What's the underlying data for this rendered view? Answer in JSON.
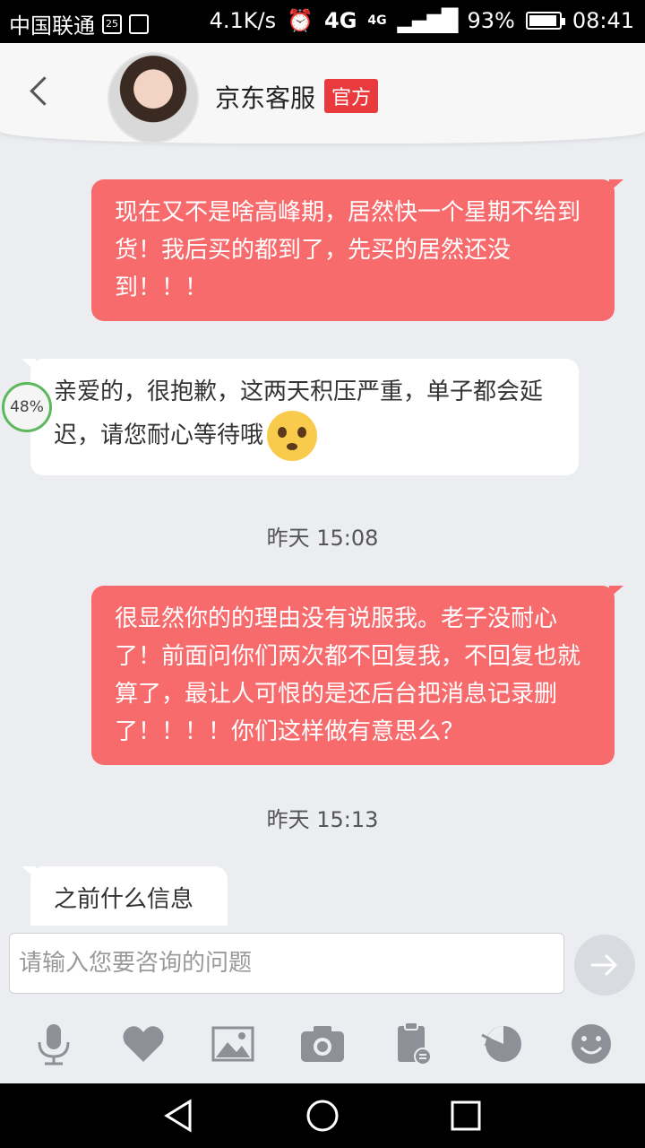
{
  "status_bar": {
    "carrier": "中国联通",
    "calendar_day": "25",
    "speed": "4.1K/s",
    "network_a": "4G",
    "network_b": "4G",
    "battery": "93%",
    "time": "08:41"
  },
  "header": {
    "name": "京东客服",
    "badge": "官方"
  },
  "messages": [
    {
      "from": "user",
      "text": "现在又不是啥高峰期，居然快一个星期不给到货！我后买的都到了，先买的居然还没到！！！"
    },
    {
      "from": "agent",
      "text": "亲爱的，很抱歉，这两天积压严重，单子都会延迟，请您耐心等待哦",
      "emoji": "pleading-face-emoji"
    },
    {
      "time": "昨天 15:08"
    },
    {
      "from": "user",
      "text": "很显然你的的理由没有说服我。老子没耐心了！前面问你们两次都不回复我，不回复也就算了，最让人可恨的是还后台把消息记录删了！！！！你们这样做有意思么？"
    },
    {
      "time": "昨天 15:13"
    },
    {
      "from": "agent",
      "text": "之前什么信息"
    }
  ],
  "overlay": {
    "progress_label": "48%",
    "progress_value": 0.48
  },
  "input": {
    "placeholder": "请输入您要咨询的问题"
  },
  "toolbar": {
    "icons": [
      "microphone-icon",
      "heart-icon",
      "image-icon",
      "camera-icon",
      "clipboard-icon",
      "history-icon",
      "smiley-icon"
    ]
  },
  "colors": {
    "user_bubble": "#f76b6d",
    "badge": "#e93b3d",
    "background": "#ebedf1"
  }
}
